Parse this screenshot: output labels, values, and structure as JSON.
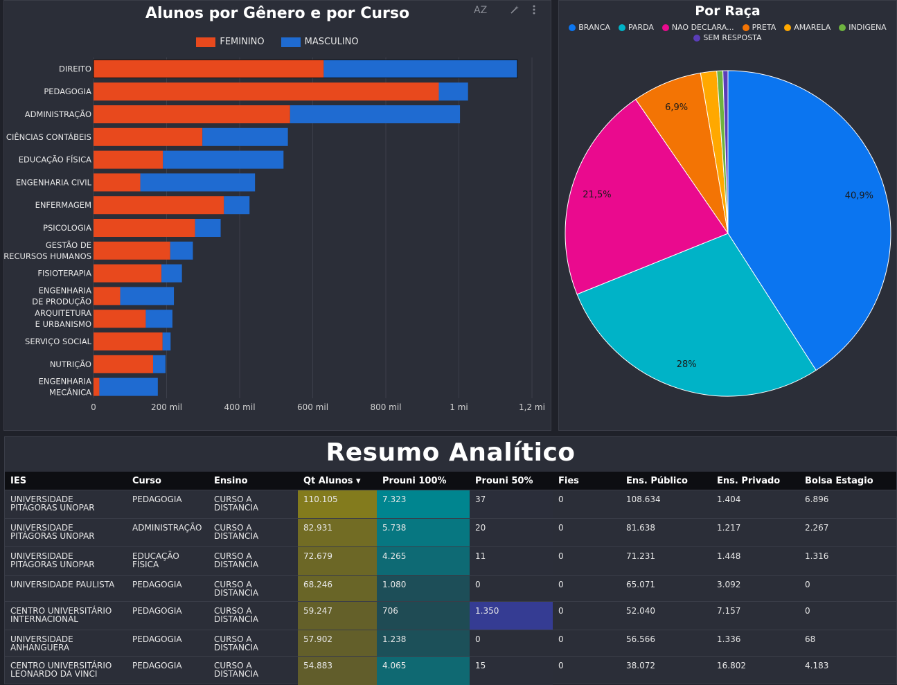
{
  "colors": {
    "feminino": "#e8491d",
    "masculino": "#1f6bd1",
    "pie": [
      "#0b75f0",
      "#00b3c7",
      "#ea0a8e",
      "#f37404",
      "#ffa800",
      "#6eb33f",
      "#5a3db8",
      "#4040c0"
    ]
  },
  "bar_panel": {
    "title": "Alunos por Gênero e por Curso",
    "sort_icon_label": "AZ",
    "icons": [
      "sort-az-icon",
      "magic-wand-icon",
      "more-vert-icon"
    ]
  },
  "pie_panel": {
    "title": "Por Raça"
  },
  "summary": {
    "title": "Resumo Analítico",
    "columns": [
      "IES",
      "Curso",
      "Ensino",
      "Qt Alunos ▾",
      "Prouni 100%",
      "Prouni 50%",
      "Fies",
      "Ens. Público",
      "Ens. Privado",
      "Bolsa Estagio"
    ],
    "rows": [
      [
        "UNIVERSIDADE PITÁGORAS UNOPAR",
        "PEDAGOGIA",
        "CURSO A DISTANCIA",
        "110.105",
        "7.323",
        "37",
        "0",
        "108.634",
        "1.404",
        "6.896"
      ],
      [
        "UNIVERSIDADE PITÁGORAS UNOPAR",
        "ADMINISTRAÇÃO",
        "CURSO A DISTANCIA",
        "82.931",
        "5.738",
        "20",
        "0",
        "81.638",
        "1.217",
        "2.267"
      ],
      [
        "UNIVERSIDADE PITÁGORAS UNOPAR",
        "EDUCAÇÃO FÍSICA",
        "CURSO A DISTANCIA",
        "72.679",
        "4.265",
        "11",
        "0",
        "71.231",
        "1.448",
        "1.316"
      ],
      [
        "UNIVERSIDADE PAULISTA",
        "PEDAGOGIA",
        "CURSO A DISTANCIA",
        "68.246",
        "1.080",
        "0",
        "0",
        "65.071",
        "3.092",
        "0"
      ],
      [
        "CENTRO UNIVERSITÁRIO INTERNACIONAL",
        "PEDAGOGIA",
        "CURSO A DISTANCIA",
        "59.247",
        "706",
        "1.350",
        "0",
        "52.040",
        "7.157",
        "0"
      ],
      [
        "UNIVERSIDADE ANHANGUERA",
        "PEDAGOGIA",
        "CURSO A DISTANCIA",
        "57.902",
        "1.238",
        "0",
        "0",
        "56.566",
        "1.336",
        "68"
      ],
      [
        "CENTRO UNIVERSITÁRIO LEONARDO DA VINCI",
        "PEDAGOGIA",
        "CURSO A DISTANCIA",
        "54.883",
        "4.065",
        "15",
        "0",
        "38.072",
        "16.802",
        "4.183"
      ]
    ]
  },
  "chart_data": [
    {
      "type": "bar",
      "orientation": "horizontal",
      "stacked": true,
      "title": "Alunos por Gênero e por Curso",
      "categories": [
        "DIREITO",
        "PEDAGOGIA",
        "ADMINISTRAÇÃO",
        "CIÊNCIAS CONTÁBEIS",
        "EDUCAÇÃO FÍSICA",
        "ENGENHARIA CIVIL",
        "ENFERMAGEM",
        "PSICOLOGIA",
        "GESTÃO DE RECURSOS HUMANOS",
        "FISIOTERAPIA",
        "ENGENHARIA DE PRODUÇÃO",
        "ARQUITETURA E URBANISMO",
        "SERVIÇO SOCIAL",
        "NUTRIÇÃO",
        "ENGENHARIA MECÂNICA"
      ],
      "series": [
        {
          "name": "FEMININO",
          "values": [
            630000,
            945000,
            538000,
            298000,
            190000,
            128000,
            357000,
            278000,
            210000,
            186000,
            73000,
            143000,
            189000,
            163000,
            16000
          ]
        },
        {
          "name": "MASCULINO",
          "values": [
            530000,
            80000,
            465000,
            234000,
            330000,
            314000,
            70000,
            70000,
            62000,
            56000,
            147000,
            73000,
            22000,
            34000,
            160000
          ]
        }
      ],
      "xlim": [
        0,
        1200000
      ],
      "xticks": [
        "0",
        "200 mil",
        "400 mil",
        "600 mil",
        "800 mil",
        "1 mi",
        "1,2 mi"
      ],
      "grid": "vertical",
      "legend": "top"
    },
    {
      "type": "pie",
      "title": "Por Raça",
      "labels": [
        "BRANCA",
        "PARDA",
        "NAO DECLARA...",
        "PRETA",
        "AMARELA",
        "INDIGENA",
        "SEM RESPOSTA"
      ],
      "values": [
        40.9,
        28.0,
        21.5,
        6.9,
        1.6,
        0.6,
        0.5
      ],
      "data_labels": [
        "40,9%",
        "28%",
        "21,5%",
        "6,9%",
        "",
        "",
        ""
      ],
      "legend": "top"
    }
  ]
}
